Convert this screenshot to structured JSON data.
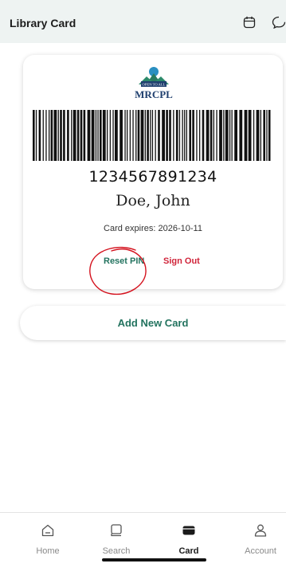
{
  "header": {
    "title": "Library Card",
    "icons": [
      "calendar-icon",
      "chat-icon"
    ]
  },
  "card": {
    "logo_banner": "OPEN TO ALL",
    "logo_name": "MRCPL",
    "number": "1234567891234",
    "holder_name": "Doe, John",
    "expiry": "Card expires: 2026-10-11",
    "reset_pin_label": "Reset PIN",
    "sign_out_label": "Sign Out"
  },
  "add_card_label": "Add New Card",
  "tabs": [
    {
      "label": "Home",
      "icon": "home-icon",
      "active": false
    },
    {
      "label": "Search",
      "icon": "book-search-icon",
      "active": false
    },
    {
      "label": "Card",
      "icon": "card-icon",
      "active": true
    },
    {
      "label": "Account",
      "icon": "account-icon",
      "active": false
    }
  ],
  "colors": {
    "accent_green": "#23735f",
    "danger_red": "#d0243a",
    "annotation_red": "#d4121e",
    "header_bg": "#eef3f2"
  }
}
